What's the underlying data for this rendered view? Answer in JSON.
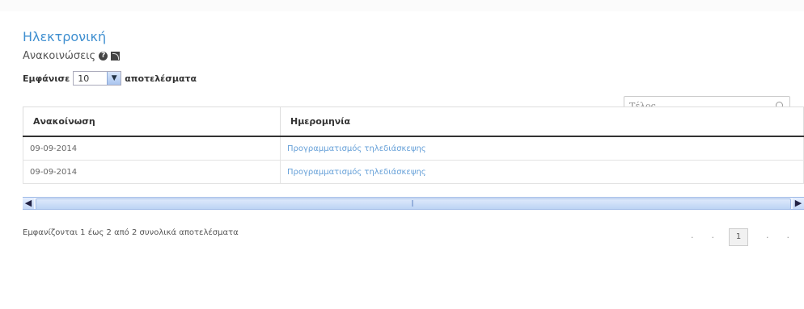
{
  "header": {
    "title": "Ηλεκτρονική",
    "subtitle": "Ανακοινώσεις"
  },
  "length_menu": {
    "prefix": "Εμφάνισε",
    "value": "10",
    "suffix": "αποτελέσματα"
  },
  "search": {
    "value": "Τέλος"
  },
  "table": {
    "columns": [
      "Ανακοίνωση",
      "Ημερομηνία"
    ],
    "rows": [
      {
        "date": "09-09-2014",
        "title": "Προγραμματισμός τηλεδιάσκεψης"
      },
      {
        "date": "09-09-2014",
        "title": "Προγραμματισμός τηλεδιάσκεψης"
      }
    ]
  },
  "footer": {
    "info": "Εμφανίζονται 1 έως 2 από 2 συνολικά αποτελέσματα",
    "current_page": "1"
  },
  "colors": {
    "title": "#3f8fd0",
    "link": "#66a0d8"
  }
}
